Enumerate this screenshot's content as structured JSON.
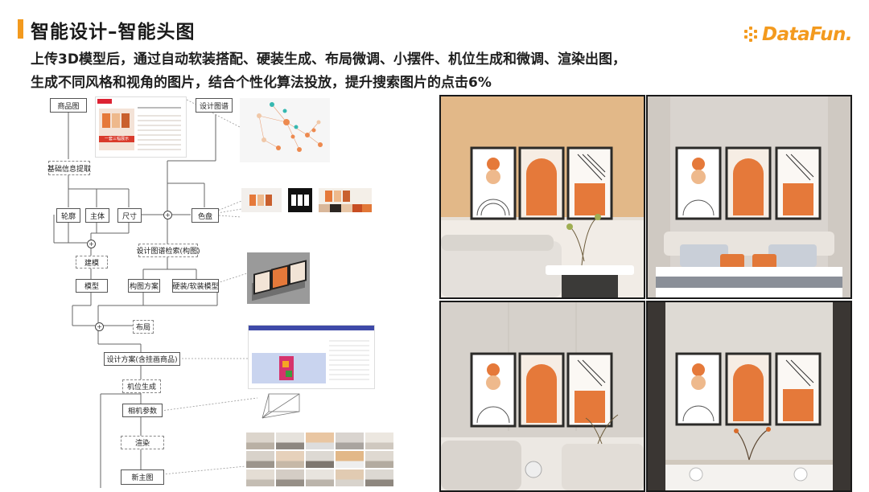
{
  "header": {
    "title": "智能设计–智能头图",
    "subtitle_line1": "上传3D模型后，通过自动软装搭配、硬装生成、布局微调、小摆件、机位生成和微调、渲染出图，",
    "subtitle_line2": "生成不同风格和视角的图片，结合个性化算法投放，提升搜索图片的点击6%"
  },
  "logo": {
    "text": "DataFun.",
    "color": "#f39a1e",
    "icon": "datafun-dots-icon"
  },
  "flowchart": {
    "nodes": {
      "product_image": "商品图",
      "design_catalog": "设计图谱",
      "basic_info": "基础信息提取",
      "contour": "轮廓",
      "subject": "主体",
      "size": "尺寸",
      "color_palette": "色盘",
      "modeling": "建模",
      "catalog_search": "设计图谱检索(构图)",
      "model": "模型",
      "composition_plan": "构图方案",
      "hard_soft_model": "硬装/软装模型",
      "layout": "布局",
      "design_plan": "设计方案(含挂画商品)",
      "camera_gen": "机位生成",
      "camera_params": "相机参数",
      "render": "渲染",
      "new_main_image": "新主图"
    },
    "product_thumb_text": "一套三幅展示"
  },
  "photos": [
    {
      "label": "living-room-warm-wall",
      "wall": "#e2b888"
    },
    {
      "label": "bedroom-panel-wall",
      "wall": "#d9d4cf"
    },
    {
      "label": "living-room-panel-wall",
      "wall": "#d6d1cb"
    },
    {
      "label": "dining-room-white-wall",
      "wall": "#dedad4"
    }
  ],
  "colors": {
    "accent": "#f39a1e",
    "orange_art": "#e5793a",
    "peach_art": "#eeb98c"
  }
}
